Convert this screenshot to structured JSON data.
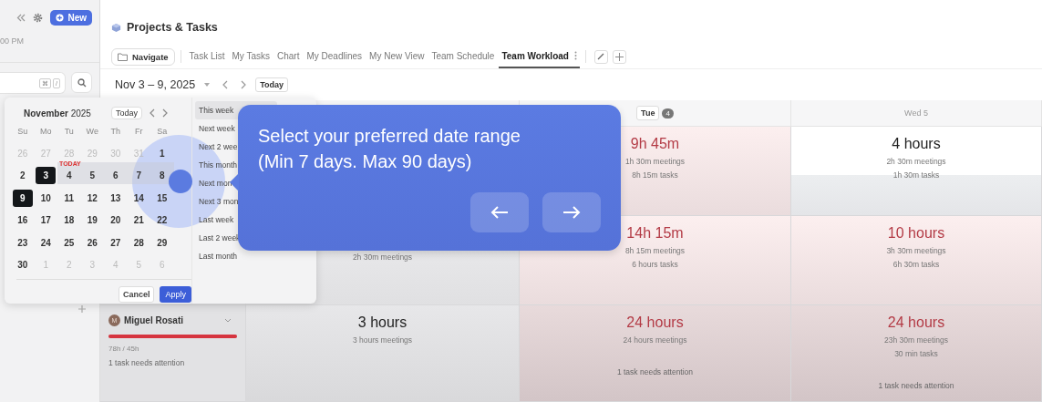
{
  "sidebar": {
    "new_button": "New",
    "time_fragment": "00 PM",
    "search": {
      "keys": [
        "⌘",
        "/"
      ]
    }
  },
  "page": {
    "title": "Projects & Tasks"
  },
  "tabs": [
    {
      "label": "Navigate",
      "kind": "button",
      "selected": false
    },
    {
      "label": "Task List",
      "kind": "tab",
      "selected": false
    },
    {
      "label": "My Tasks",
      "kind": "tab",
      "selected": false
    },
    {
      "label": "Chart",
      "kind": "tab",
      "selected": false
    },
    {
      "label": "My Deadlines",
      "kind": "tab",
      "selected": false
    },
    {
      "label": "My New View",
      "kind": "tab",
      "selected": false
    },
    {
      "label": "Team Schedule",
      "kind": "tab",
      "selected": false
    },
    {
      "label": "Team Workload",
      "kind": "tab",
      "selected": true
    }
  ],
  "toolbar": {
    "range": "Nov 3 – 9, 2025",
    "today": "Today"
  },
  "grid": {
    "columns": [
      "",
      {
        "label": "Tue",
        "badge": "4",
        "today": true
      },
      {
        "label": "Wed 5",
        "today": false
      }
    ],
    "rows": [
      {
        "person": null,
        "cells": [
          null,
          {
            "overloaded": true,
            "total": "9h 45m",
            "lines": [
              "1h 30m meetings",
              "8h 15m tasks"
            ]
          },
          {
            "overloaded": false,
            "total": "4 hours",
            "lines": [
              "2h 30m meetings",
              "1h 30m tasks"
            ]
          }
        ]
      },
      {
        "person": null,
        "cells": [
          {
            "overloaded": false,
            "lines": [
              "2h 30m meetings"
            ]
          },
          {
            "overloaded": true,
            "total": "14h 15m",
            "lines": [
              "8h 15m meetings",
              "6 hours tasks"
            ]
          },
          {
            "overloaded": true,
            "total": "10 hours",
            "lines": [
              "3h 30m meetings",
              "6h 30m tasks"
            ]
          }
        ]
      },
      {
        "person": {
          "initial": "M",
          "name": "Miguel Rosati",
          "level": 1,
          "hours": "78h / 45h",
          "note": "1 task needs attention"
        },
        "cells": [
          {
            "overloaded": false,
            "total": "3 hours",
            "lines": [
              "3 hours meetings"
            ]
          },
          {
            "overloaded": true,
            "total": "24 hours",
            "lines": [
              "24 hours meetings"
            ],
            "note": "1 task needs attention"
          },
          {
            "overloaded": true,
            "total": "24 hours",
            "lines": [
              "23h 30m meetings",
              "30 min tasks"
            ],
            "note": "1 task needs attention"
          }
        ]
      }
    ]
  },
  "calendar": {
    "title": "**November** 2025",
    "today_button": "Today",
    "weekdays": [
      "Su",
      "Mo",
      "Tu",
      "We",
      "Th",
      "Fr",
      "Sa"
    ],
    "weeks": [
      [
        {
          "label": "26",
          "outside": true
        },
        {
          "label": "27",
          "outside": true
        },
        {
          "label": "28",
          "outside": true
        },
        {
          "label": "29",
          "outside": true
        },
        {
          "label": "30",
          "outside": true
        },
        {
          "label": "31",
          "outside": true
        },
        {
          "label": "1",
          "outside": false
        }
      ],
      [
        {
          "label": "2",
          "outside": false
        },
        {
          "label": "3",
          "outside": false,
          "selected": true
        },
        {
          "label": "4",
          "outside": false,
          "in_range": true,
          "today_label": "TODAY"
        },
        {
          "label": "5",
          "outside": false,
          "in_range": true
        },
        {
          "label": "6",
          "outside": false,
          "in_range": true
        },
        {
          "label": "7",
          "outside": false,
          "in_range": true
        },
        {
          "label": "8",
          "outside": false,
          "in_range": true
        }
      ],
      [
        {
          "label": "9",
          "outside": false,
          "selected": true
        },
        {
          "label": "10",
          "outside": false
        },
        {
          "label": "11",
          "outside": false
        },
        {
          "label": "12",
          "outside": false
        },
        {
          "label": "13",
          "outside": false
        },
        {
          "label": "14",
          "outside": false
        },
        {
          "label": "15",
          "outside": false
        }
      ],
      [
        {
          "label": "16",
          "outside": false
        },
        {
          "label": "17",
          "outside": false
        },
        {
          "label": "18",
          "outside": false
        },
        {
          "label": "19",
          "outside": false
        },
        {
          "label": "20",
          "outside": false
        },
        {
          "label": "21",
          "outside": false
        },
        {
          "label": "22",
          "outside": false
        }
      ],
      [
        {
          "label": "23",
          "outside": false
        },
        {
          "label": "24",
          "outside": false
        },
        {
          "label": "25",
          "outside": false
        },
        {
          "label": "26",
          "outside": false
        },
        {
          "label": "27",
          "outside": false
        },
        {
          "label": "28",
          "outside": false
        },
        {
          "label": "29",
          "outside": false
        }
      ],
      [
        {
          "label": "30",
          "outside": false
        },
        {
          "label": "1",
          "outside": true
        },
        {
          "label": "2",
          "outside": true
        },
        {
          "label": "3",
          "outside": true
        },
        {
          "label": "4",
          "outside": true
        },
        {
          "label": "5",
          "outside": true
        },
        {
          "label": "6",
          "outside": true
        }
      ]
    ],
    "presets": [
      {
        "label": "This week",
        "selected": true
      },
      {
        "label": "Next week",
        "selected": false
      },
      {
        "label": "Next 2 wee",
        "selected": false
      },
      {
        "label": "This month",
        "selected": false
      },
      {
        "label": "Next mon",
        "selected": false
      },
      {
        "label": "Next 3 mon",
        "selected": false
      },
      {
        "label": "Last week",
        "selected": false
      },
      {
        "label": "Last 2 week",
        "selected": false
      },
      {
        "label": "Last month",
        "selected": false
      }
    ],
    "cancel": "Cancel",
    "apply": "Apply"
  },
  "tour": {
    "lines": [
      "Select your preferred date range",
      "(Min 7 days. Max 90 days)"
    ]
  }
}
